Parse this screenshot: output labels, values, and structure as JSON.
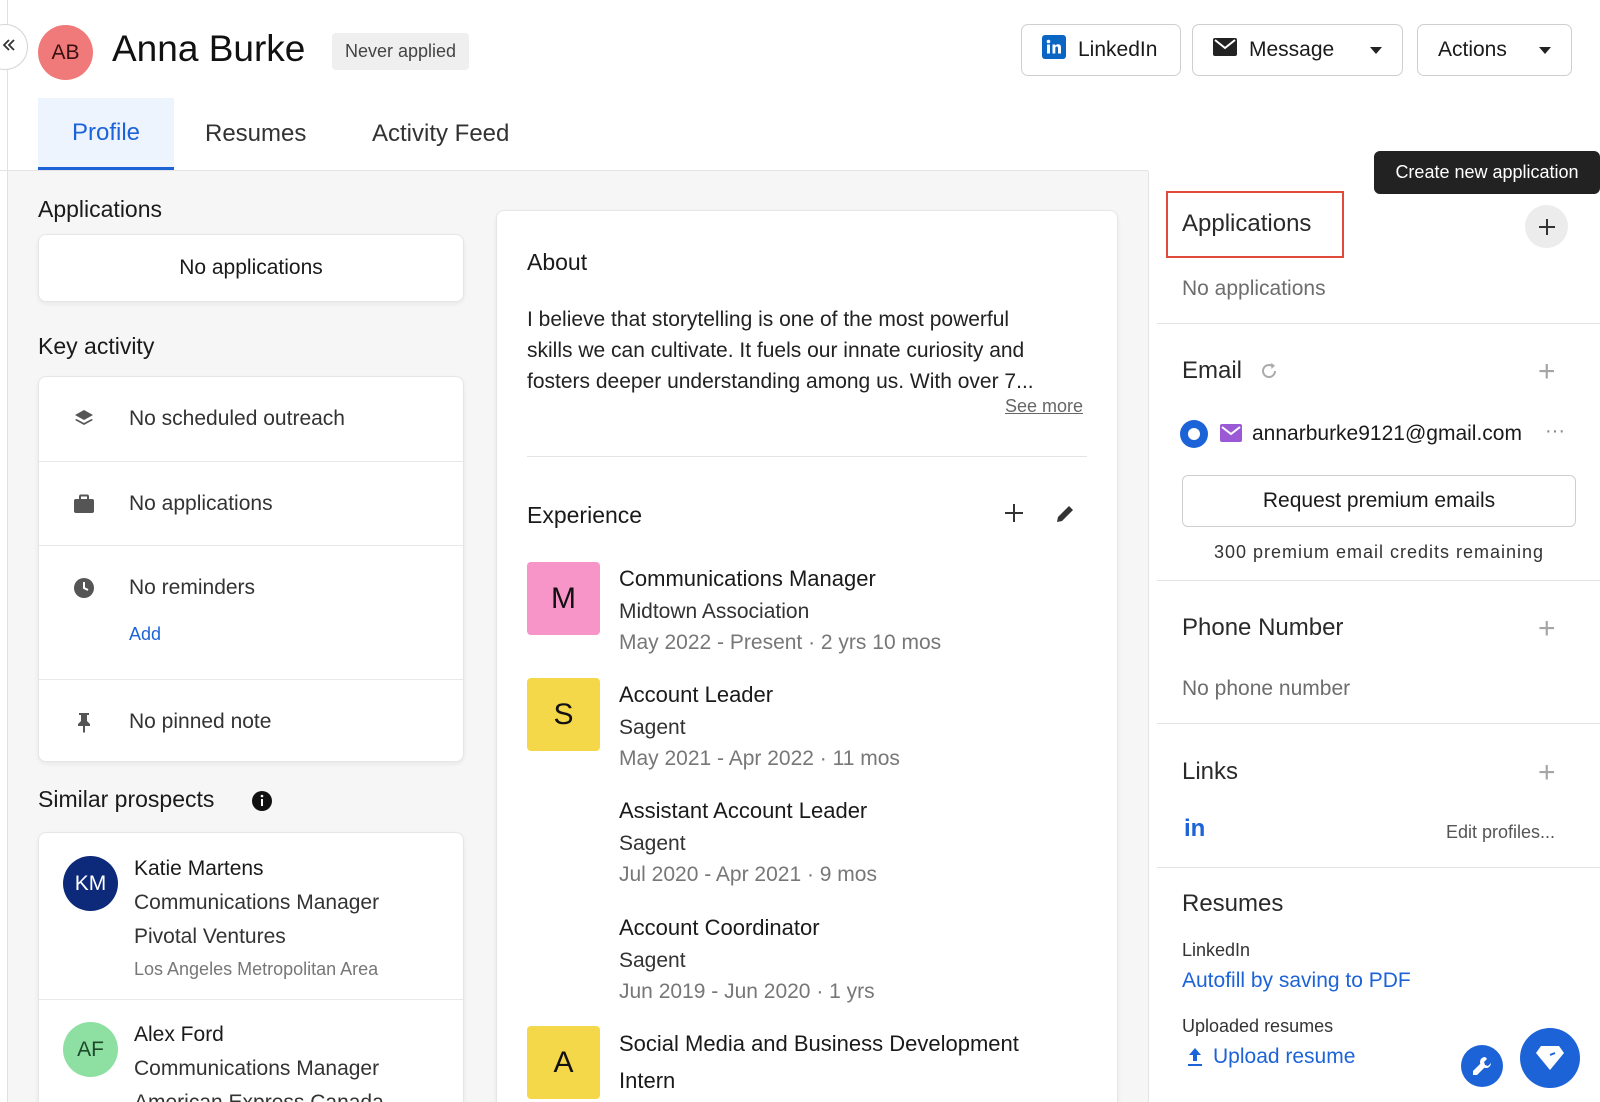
{
  "header": {
    "avatar_initials": "AB",
    "name": "Anna Burke",
    "status_badge": "Never applied",
    "linkedin_label": "LinkedIn",
    "message_label": "Message",
    "actions_label": "Actions"
  },
  "tabs": [
    {
      "label": "Profile",
      "active": true
    },
    {
      "label": "Resumes",
      "active": false
    },
    {
      "label": "Activity Feed",
      "active": false
    }
  ],
  "left": {
    "applications_title": "Applications",
    "applications_empty": "No applications",
    "key_activity_title": "Key activity",
    "key_activity": [
      {
        "icon": "layers-icon",
        "text": "No scheduled outreach"
      },
      {
        "icon": "briefcase-icon",
        "text": "No applications"
      },
      {
        "icon": "clock-icon",
        "text": "No reminders",
        "action": "Add"
      },
      {
        "icon": "pin-icon",
        "text": "No pinned note"
      }
    ],
    "similar_title": "Similar prospects",
    "prospects": [
      {
        "initials": "KM",
        "name": "Katie Martens",
        "title": "Communications Manager",
        "company": "Pivotal Ventures",
        "location": "Los Angeles Metropolitan Area",
        "color": "#0d2a7a"
      },
      {
        "initials": "AF",
        "name": "Alex Ford",
        "title": "Communications Manager",
        "company": "American Express Canada",
        "color": "#8ee0a2"
      }
    ]
  },
  "about": {
    "title": "About",
    "lines": [
      "I believe that storytelling is one of the most powerful",
      "skills we can cultivate. It fuels our innate curiosity and",
      "fosters deeper understanding among us. With over 7..."
    ],
    "see_more": "See more"
  },
  "experience": {
    "title": "Experience",
    "items": [
      {
        "logo": "M",
        "logo_color": "#f895c8",
        "title": "Communications Manager",
        "company": "Midtown Association",
        "dates": "May 2022 - Present · 2 yrs 10 mos"
      },
      {
        "logo": "S",
        "logo_color": "#f5d84a",
        "title": "Account Leader",
        "company": "Sagent",
        "dates": "May 2021 - Apr 2022 · 11 mos"
      },
      {
        "logo": "",
        "logo_color": "",
        "title": "Assistant Account Leader",
        "company": "Sagent",
        "dates": "Jul 2020 - Apr 2021 · 9 mos"
      },
      {
        "logo": "",
        "logo_color": "",
        "title": "Account Coordinator",
        "company": "Sagent",
        "dates": "Jun 2019 - Jun 2020 · 1 yrs"
      },
      {
        "logo": "A",
        "logo_color": "#f5d84a",
        "title": "Social Media and Business Development",
        "title_line2": "Intern"
      }
    ]
  },
  "right": {
    "tooltip": "Create new application",
    "applications_title": "Applications",
    "applications_empty": "No applications",
    "email_title": "Email",
    "email_address": "annarburke9121@gmail.com",
    "request_premium": "Request premium emails",
    "credits": "300 premium email credits remaining",
    "phone_title": "Phone Number",
    "phone_empty": "No phone number",
    "links_title": "Links",
    "edit_profiles": "Edit profiles...",
    "resumes_title": "Resumes",
    "resumes_linkedin": "LinkedIn",
    "autofill": "Autofill by saving to PDF",
    "uploaded_resumes": "Uploaded resumes",
    "upload_resume": "Upload resume"
  },
  "colors": {
    "accent": "#1d63d8",
    "highlight": "#e04a3a",
    "email_icon": "#9b59d6"
  }
}
